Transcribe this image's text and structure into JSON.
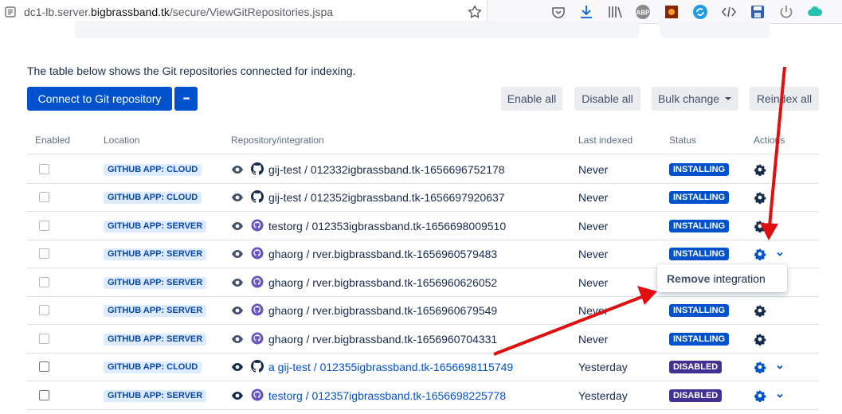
{
  "browser": {
    "url_prefix": "dc1-lb.server.",
    "url_domain": "bigbrassband.tk",
    "url_path": "/secure/ViewGitRepositories.jspa",
    "toolbar_icons": [
      "pocket-icon",
      "download-icon",
      "library-icon",
      "adblock-icon",
      "extension-icon",
      "sync-icon",
      "devtools-icon",
      "save-icon",
      "power-icon",
      "cloud-icon"
    ]
  },
  "intro_text": "The table below shows the Git repositories connected for indexing.",
  "toolbar": {
    "connect_label": "Connect to Git repository",
    "more_label": "•••",
    "enable_all": "Enable all",
    "disable_all": "Disable all",
    "bulk_change": "Bulk change",
    "reindex_all": "Reindex all"
  },
  "columns": {
    "enabled": "Enabled",
    "location": "Location",
    "repository": "Repository/integration",
    "last_indexed": "Last indexed",
    "status": "Status",
    "actions": "Actions"
  },
  "rows": [
    {
      "location": "GITHUB APP: CLOUD",
      "repo": "gij-test / 012332igbrassband.tk-1656696752178",
      "last": "Never",
      "status": "INSTALLING"
    },
    {
      "location": "GITHUB APP: CLOUD",
      "repo": "gij-test / 012352igbrassband.tk-1656697920637",
      "last": "Never",
      "status": "INSTALLING"
    },
    {
      "location": "GITHUB APP: SERVER",
      "repo": "testorg / 012353igbrassband.tk-1656698009510",
      "last": "Never",
      "status": "INSTALLING"
    },
    {
      "location": "GITHUB APP: SERVER",
      "repo": "ghaorg / rver.bigbrassband.tk-1656960579483",
      "last": "Never",
      "status": "INSTALLING"
    },
    {
      "location": "GITHUB APP: SERVER",
      "repo": "ghaorg / rver.bigbrassband.tk-1656960626052",
      "last": "Never",
      "status": ""
    },
    {
      "location": "GITHUB APP: SERVER",
      "repo": "ghaorg / rver.bigbrassband.tk-1656960679549",
      "last": "Never",
      "status": "INSTALLING"
    },
    {
      "location": "GITHUB APP: SERVER",
      "repo": "ghaorg / rver.bigbrassband.tk-1656960704331",
      "last": "Never",
      "status": "INSTALLING"
    },
    {
      "location": "GITHUB APP: CLOUD",
      "repo": "a gij-test / 012355igbrassband.tk-1656698115749",
      "last": "Yesterday",
      "status": "DISABLED"
    },
    {
      "location": "GITHUB APP: SERVER",
      "repo": "testorg / 012357igbrassband.tk-1656698225778",
      "last": "Yesterday",
      "status": "DISABLED"
    }
  ],
  "dropdown": {
    "bold": "Remove",
    "rest": "integration"
  },
  "colors": {
    "primary": "#0052cc",
    "installing": "#0052cc",
    "disabled": "#403294",
    "lozenge_bg": "#deebff",
    "annotation_arrow": "#e01010"
  }
}
